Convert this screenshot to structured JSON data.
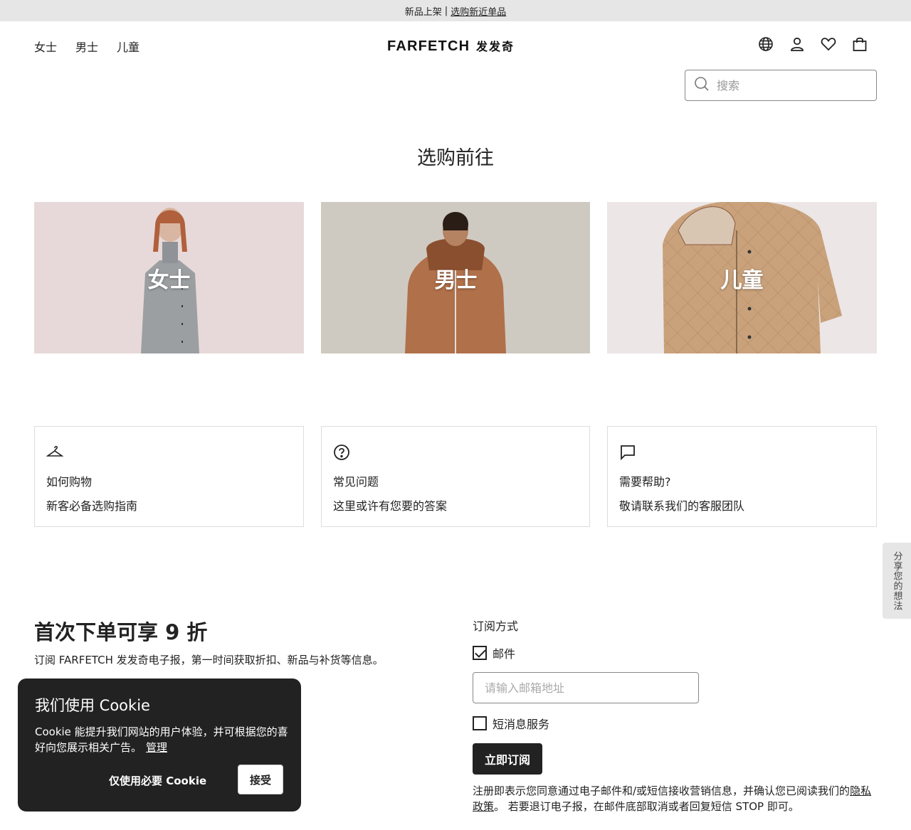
{
  "promo_bar": {
    "text": "新品上架",
    "separator": "|",
    "link": "选购新近单品"
  },
  "header": {
    "nav": [
      "女士",
      "男士",
      "儿童"
    ],
    "logo": "FARFETCH",
    "logo_cn": "发发奇",
    "icons": [
      "globe-icon",
      "account-icon",
      "heart-icon",
      "bag-icon"
    ]
  },
  "search": {
    "placeholder": "搜索"
  },
  "shop_section": {
    "title": "选购前往",
    "categories": [
      {
        "label": "女士",
        "bg": "#e6d8d8"
      },
      {
        "label": "男士",
        "bg": "#cfcac1"
      },
      {
        "label": "儿童",
        "bg": "#ece6e6"
      }
    ]
  },
  "help": [
    {
      "icon": "hanger-icon",
      "title": "如何购物",
      "subtitle": "新客必备选购指南"
    },
    {
      "icon": "question-icon",
      "title": "常见问题",
      "subtitle": "这里或许有您要的答案"
    },
    {
      "icon": "chat-icon",
      "title": "需要帮助?",
      "subtitle": "敬请联系我们的客服团队"
    }
  ],
  "feedback": "分享您的想法",
  "newsletter": {
    "headline": "首次下单可享 9 折",
    "description": "订阅 FARFETCH 发发奇电子报，第一时间获取折扣、新品与补货等信息。",
    "method_label": "订阅方式",
    "email_option": "邮件",
    "email_checked": true,
    "email_placeholder": "请输入邮箱地址",
    "sms_option": "短消息服务",
    "sms_checked": false,
    "subscribe": "立即订阅",
    "legal_before": "注册即表示您同意通过电子邮件和/或短信接收营销信息，并确认您已阅读我们的",
    "legal_link": "隐私政策",
    "legal_after": "。 若要退订电子报，在邮件底部取消或者回复短信 STOP 即可。"
  },
  "cookie": {
    "title": "我们使用 Cookie",
    "text": "Cookie 能提升我们网站的用户体验，并可根据您的喜好向您展示相关广告。",
    "manage": "管理",
    "essential": "仅使用必要 Cookie",
    "accept": "接受"
  }
}
